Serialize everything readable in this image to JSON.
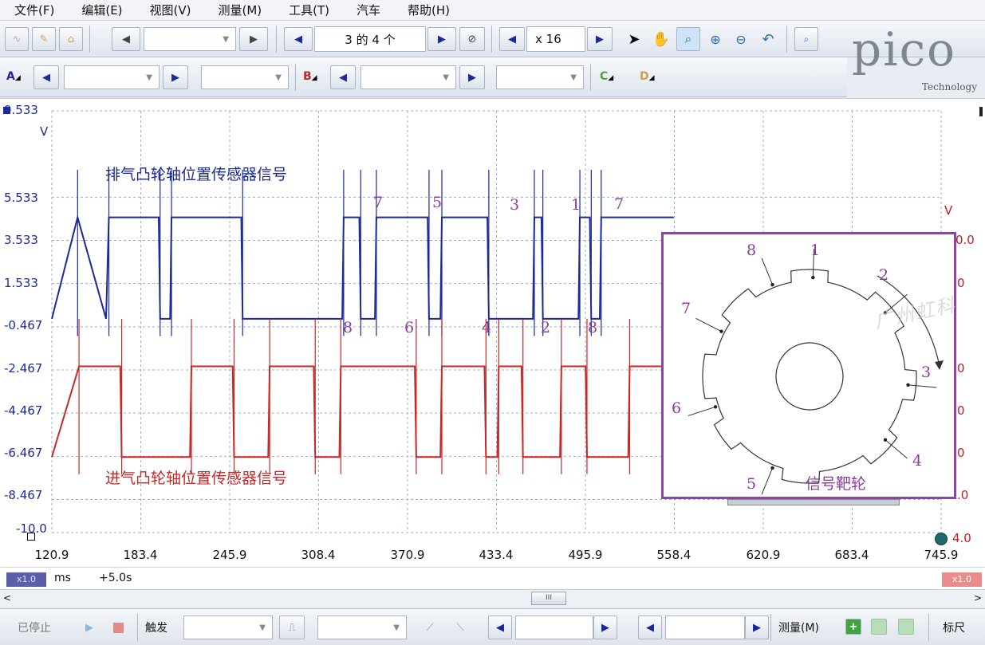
{
  "menu": [
    "文件(F)",
    "编辑(E)",
    "视图(V)",
    "测量(M)",
    "工具(T)",
    "汽车",
    "帮助(H)"
  ],
  "toolbar": {
    "buffer_page": "3 的 4 个",
    "zoom": "x 16"
  },
  "channels": {
    "a": "A",
    "b": "B",
    "c": "C",
    "d": "D"
  },
  "logo": {
    "brand": "pico",
    "sub": "Technology"
  },
  "colors": {
    "channel_a": "#1a2a9a",
    "channel_b": "#c62828",
    "annotation": "#8a3d9c",
    "grid": "#9bb3cf"
  },
  "scope": {
    "y_axis_left": {
      "unit": "V",
      "ticks": [
        "9.533",
        "5.533",
        "3.533",
        "1.533",
        "-0.467",
        "-2.467",
        "-4.467",
        "-6.467",
        "-8.467",
        "-10.0"
      ]
    },
    "y_axis_right": {
      "unit": "V",
      "ticks": [
        "0.0",
        "0",
        "0",
        "0",
        "0",
        ".0",
        "4.0"
      ]
    },
    "x_axis": {
      "unit": "ms",
      "ticks": [
        "120.9",
        "183.4",
        "245.9",
        "308.4",
        "370.9",
        "433.4",
        "495.9",
        "558.4",
        "620.9",
        "683.4",
        "745.9"
      ]
    },
    "trace_a_label": "排气凸轮轴位置传感器信号",
    "trace_b_label": "进气凸轮轴位置传感器信号",
    "tooth_labels": [
      "7",
      "5",
      "3",
      "1",
      "7",
      "8",
      "6",
      "4",
      "2",
      "8"
    ],
    "watermark": "广州虹科"
  },
  "chart_data": {
    "type": "line",
    "xlabel": "ms",
    "ylabel": "V",
    "xlim": [
      120.9,
      745.9
    ],
    "ylim": [
      -10.0,
      9.533
    ],
    "grid": true,
    "series": [
      {
        "name": "排气凸轮轴位置传感器信号",
        "color": "#1a2a9a",
        "low": -0.1,
        "high": 4.6,
        "transitions": [
          [
            120.9,
            -0.1
          ],
          [
            139,
            4.6
          ],
          [
            159,
            -0.1
          ],
          [
            161,
            4.6
          ],
          [
            196,
            4.6
          ],
          [
            197,
            -0.1
          ],
          [
            204,
            -0.1
          ],
          [
            205,
            4.6
          ],
          [
            254,
            4.6
          ],
          [
            255,
            -0.1
          ],
          [
            325,
            -0.1
          ],
          [
            326,
            4.6
          ],
          [
            337,
            4.6
          ],
          [
            338,
            -0.1
          ],
          [
            348,
            -0.1
          ],
          [
            349,
            4.6
          ],
          [
            385,
            4.6
          ],
          [
            386,
            -0.1
          ],
          [
            394,
            -0.1
          ],
          [
            395,
            4.6
          ],
          [
            427,
            4.6
          ],
          [
            428,
            -0.1
          ],
          [
            459,
            -0.1
          ],
          [
            460,
            4.6
          ],
          [
            465,
            4.6
          ],
          [
            466,
            -0.1
          ],
          [
            491,
            -0.1
          ],
          [
            492,
            4.6
          ],
          [
            499,
            4.6
          ],
          [
            500,
            -0.1
          ],
          [
            506,
            -0.1
          ],
          [
            507,
            4.6
          ],
          [
            558,
            4.6
          ]
        ]
      },
      {
        "name": "进气凸轮轴位置传感器信号",
        "color": "#c62828",
        "low": -6.5,
        "high": -2.3,
        "transitions": [
          [
            120.9,
            -6.5
          ],
          [
            140,
            -2.3
          ],
          [
            169,
            -2.3
          ],
          [
            170,
            -6.5
          ],
          [
            218,
            -6.5
          ],
          [
            219,
            -2.3
          ],
          [
            248,
            -2.3
          ],
          [
            249,
            -6.5
          ],
          [
            273,
            -6.5
          ],
          [
            274,
            -2.3
          ],
          [
            305,
            -2.3
          ],
          [
            306,
            -6.5
          ],
          [
            323,
            -6.5
          ],
          [
            324,
            -2.3
          ],
          [
            376,
            -2.3
          ],
          [
            377,
            -6.5
          ],
          [
            394,
            -6.5
          ],
          [
            395,
            -2.3
          ],
          [
            425,
            -2.3
          ],
          [
            426,
            -6.5
          ],
          [
            434,
            -6.5
          ],
          [
            435,
            -2.3
          ],
          [
            451,
            -2.3
          ],
          [
            452,
            -6.5
          ],
          [
            478,
            -6.5
          ],
          [
            479,
            -2.3
          ],
          [
            496,
            -2.3
          ],
          [
            497,
            -6.5
          ],
          [
            526,
            -6.5
          ],
          [
            527,
            -2.3
          ],
          [
            558,
            -2.3
          ]
        ]
      }
    ]
  },
  "inset": {
    "title": "信号靶轮",
    "labels": [
      "1",
      "2",
      "3",
      "4",
      "5",
      "6",
      "7",
      "8"
    ]
  },
  "status": {
    "x_scale": "x1.0",
    "unit": "ms",
    "offset": "+5.0s",
    "right_scale": "x1.0"
  },
  "bottom": {
    "stopped": "已停止",
    "trigger": "触发",
    "measure": "测量(M)",
    "ruler": "标尺"
  }
}
